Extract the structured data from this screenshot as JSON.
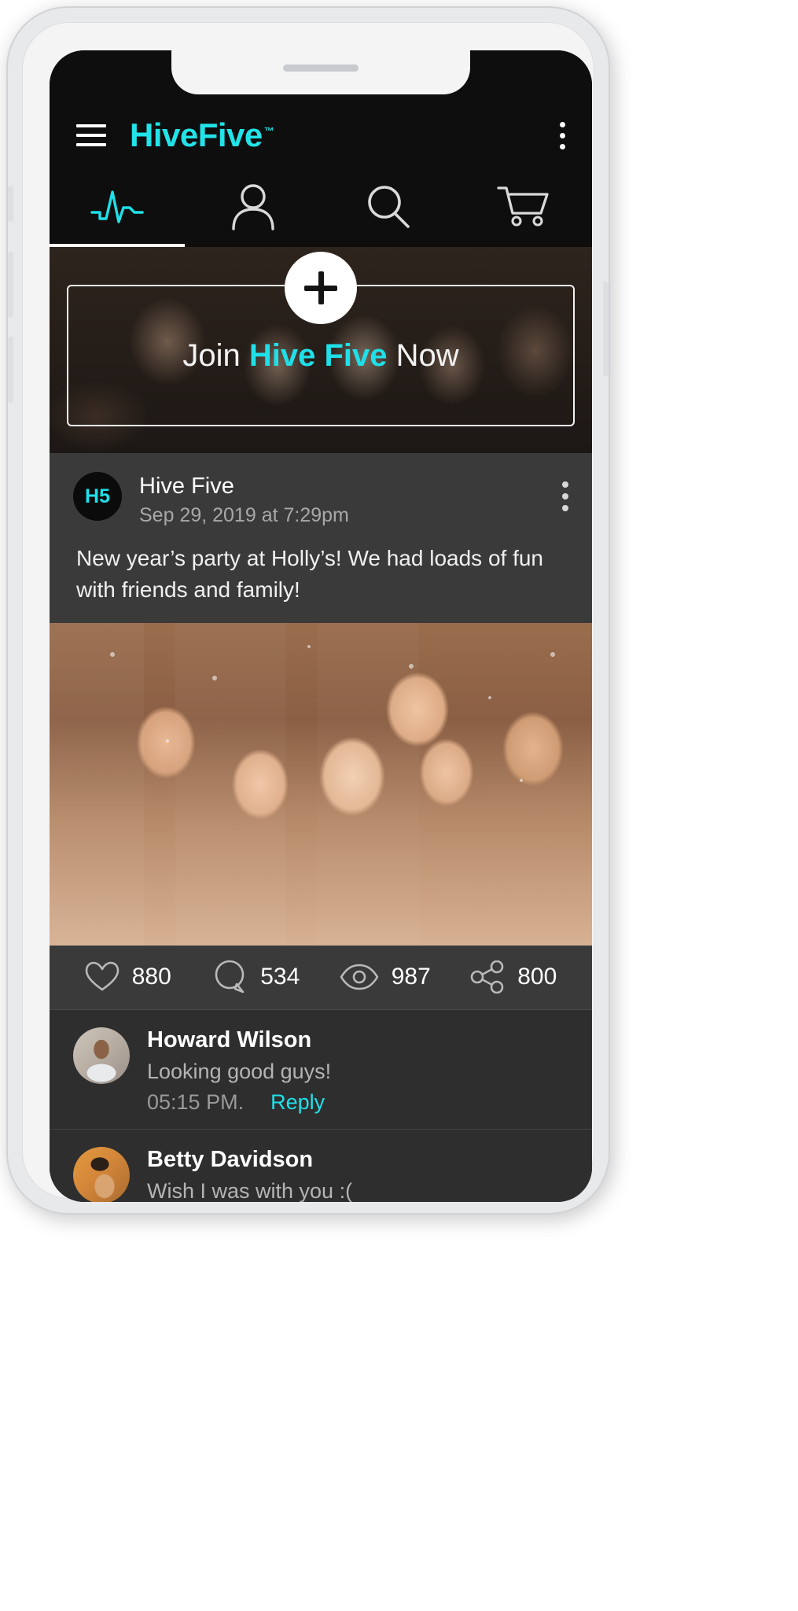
{
  "app": {
    "brand": "HiveFive",
    "trademark": "™",
    "accent_color": "#1fe0e8",
    "header_bg": "#0e0e0e"
  },
  "header": {
    "menu_icon": "hamburger-menu-icon",
    "overflow_icon": "kebab-menu-icon"
  },
  "tabs": [
    {
      "icon": "activity-pulse-icon",
      "label": "Activity",
      "active": true
    },
    {
      "icon": "person-icon",
      "label": "Profile",
      "active": false
    },
    {
      "icon": "search-icon",
      "label": "Search",
      "active": false
    },
    {
      "icon": "shopping-cart-icon",
      "label": "Cart",
      "active": false
    }
  ],
  "join_banner": {
    "plus_icon": "plus-icon",
    "text_prefix": "Join ",
    "text_accent": "Hive Five",
    "text_suffix": " Now"
  },
  "post": {
    "avatar_initials": "H5",
    "author": "Hive Five",
    "date": "Sep 29, 2019 at 7:29pm",
    "overflow_icon": "kebab-menu-icon",
    "body": "New year’s party at Holly’s! We had loads of fun with friends and family!",
    "photo_alt": "group-selfie-photo",
    "stats": [
      {
        "icon": "heart-icon",
        "name": "likes",
        "value": "880"
      },
      {
        "icon": "comment-bubble-icon",
        "name": "comments",
        "value": "534"
      },
      {
        "icon": "eye-icon",
        "name": "views",
        "value": "987"
      },
      {
        "icon": "share-icon",
        "name": "shares",
        "value": "800"
      }
    ]
  },
  "comments": [
    {
      "avatar": "howard",
      "name": "Howard Wilson",
      "text": "Looking good guys!",
      "time": "05:15 PM.",
      "reply_label": "Reply"
    },
    {
      "avatar": "betty",
      "name": "Betty Davidson",
      "text": "Wish I was with you :(",
      "time": "",
      "reply_label": ""
    }
  ]
}
